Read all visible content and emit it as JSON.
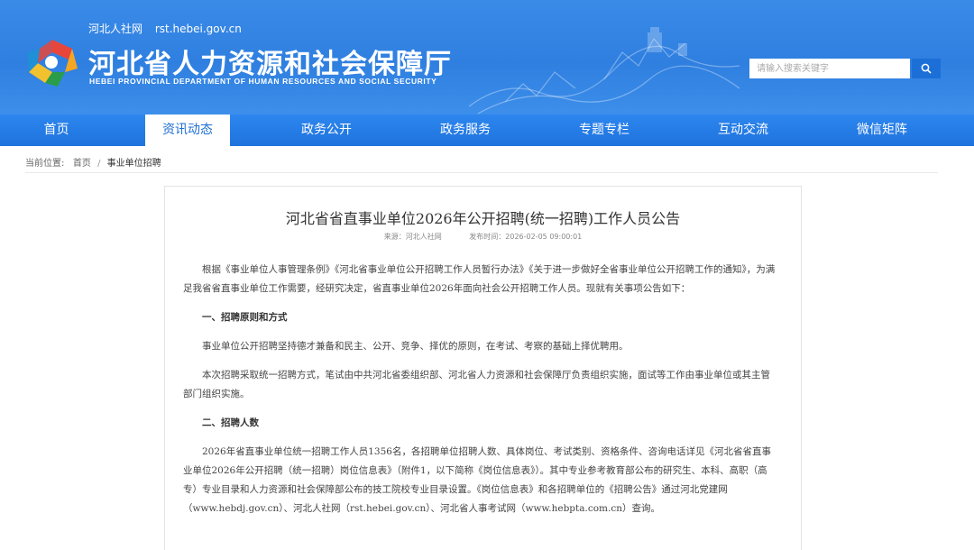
{
  "header": {
    "site_short": "河北人社网",
    "domain": "rst.hebei.gov.cn",
    "org_name_cn": "河北省人力资源和社会保障厅",
    "org_name_en": "HEBEI PROVINCIAL DEPARTMENT OF HUMAN RESOURCES AND SOCIAL SECURITY",
    "search_placeholder": "请输入搜索关键字"
  },
  "nav": {
    "items": [
      "首页",
      "资讯动态",
      "政务公开",
      "政务服务",
      "专题专栏",
      "互动交流",
      "微信矩阵"
    ],
    "active_index": 1
  },
  "breadcrumb": {
    "label": "当前位置:",
    "home": "首页",
    "separator": "/",
    "current": "事业单位招聘"
  },
  "article": {
    "title": "河北省省直事业单位2026年公开招聘(统一招聘)工作人员公告",
    "source": "来源：河北人社网",
    "published": "发布时间：2026-02-05 09:00:01",
    "p1": "根据《事业单位人事管理条例》《河北省事业单位公开招聘工作人员暂行办法》《关于进一步做好全省事业单位公开招聘工作的通知》，为满足我省省直事业单位工作需要，经研究决定，省直事业单位2026年面向社会公开招聘工作人员。现就有关事项公告如下：",
    "h1": "一、招聘原则和方式",
    "p2": "事业单位公开招聘坚持德才兼备和民主、公开、竞争、择优的原则，在考试、考察的基础上择优聘用。",
    "p3": "本次招聘采取统一招聘方式，笔试由中共河北省委组织部、河北省人力资源和社会保障厅负责组织实施，面试等工作由事业单位或其主管部门组织实施。",
    "h2": "二、招聘人数",
    "p4": "2026年省直事业单位统一招聘工作人员1356名，各招聘单位招聘人数、具体岗位、考试类别、资格条件、咨询电话详见《河北省省直事业单位2026年公开招聘（统一招聘）岗位信息表》（附件1，以下简称《岗位信息表》）。其中专业参考教育部公布的研究生、本科、高职（高专）专业目录和人力资源和社会保障部公布的技工院校专业目录设置。《岗位信息表》和各招聘单位的《招聘公告》通过河北党建网（www.hebdj.gov.cn）、河北人社网（rst.hebei.gov.cn）、河北省人事考试网（www.hebpta.com.cn）查询。"
  },
  "colors": {
    "header_blue": "#2f7fe0",
    "nav_blue": "#1f73dd",
    "active_text": "#1f6fd3"
  }
}
